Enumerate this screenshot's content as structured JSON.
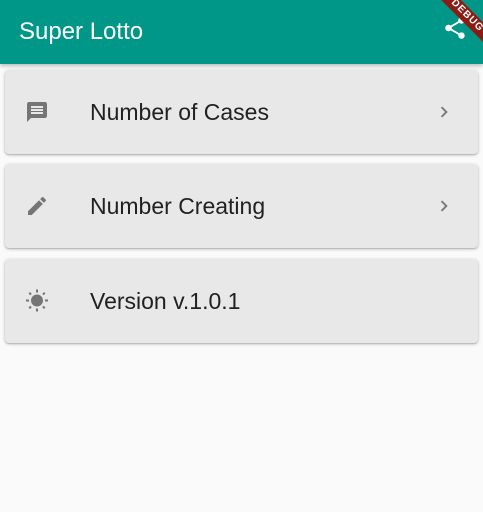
{
  "app_bar": {
    "title": "Super Lotto",
    "background_color": "#009688",
    "action_icon": "share-icon"
  },
  "debug_banner": {
    "label": "DEBUG",
    "color": "#8b1c13"
  },
  "menu": {
    "items": [
      {
        "label": "Number of Cases",
        "leading_icon": "message-icon",
        "trailing_icon": "chevron-right-icon"
      },
      {
        "label": "Number Creating",
        "leading_icon": "pencil-icon",
        "trailing_icon": "chevron-right-icon"
      },
      {
        "label": "Version v.1.0.1",
        "leading_icon": "brightness-icon"
      }
    ],
    "card_color": "#e8e8e8",
    "icon_color": "#757575"
  }
}
